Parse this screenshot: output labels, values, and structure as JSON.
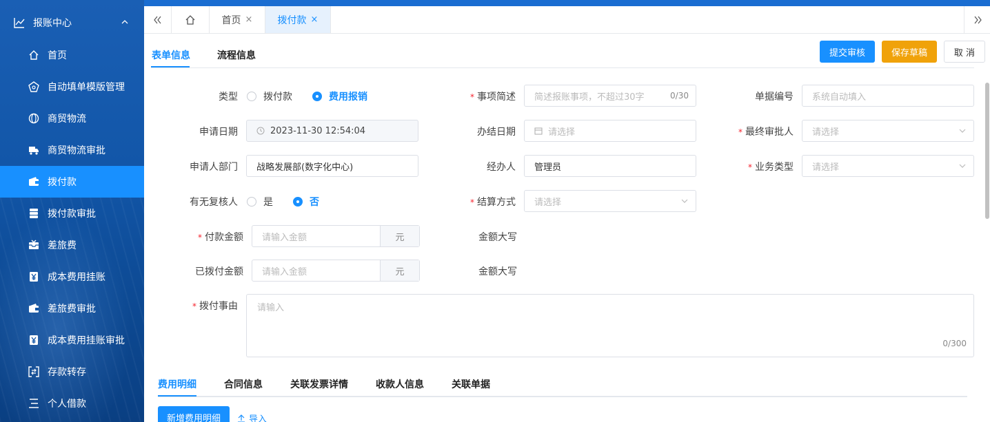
{
  "sidebar": {
    "group_label": "报账中心",
    "items": [
      {
        "label": "首页",
        "icon": "home-icon"
      },
      {
        "label": "自动填单模版管理",
        "icon": "template-icon"
      },
      {
        "label": "商贸物流",
        "icon": "globe-icon"
      },
      {
        "label": "商贸物流审批",
        "icon": "truck-icon"
      },
      {
        "label": "拨付款",
        "icon": "wallet-icon",
        "active": true
      },
      {
        "label": "拨付款审批",
        "icon": "server-icon"
      },
      {
        "label": "差旅费",
        "icon": "inbox-icon"
      },
      {
        "label": "成本费用挂账",
        "icon": "yen-icon"
      },
      {
        "label": "差旅费审批",
        "icon": "wallet-icon"
      },
      {
        "label": "成本费用挂账审批",
        "icon": "yen-icon"
      },
      {
        "label": "存款转存",
        "icon": "transfer-icon"
      },
      {
        "label": "个人借款",
        "icon": "list-icon"
      }
    ]
  },
  "tabbar": {
    "tabs": [
      {
        "label": "首页",
        "close": "×"
      },
      {
        "label": "拨付款",
        "close": "×",
        "active": true
      }
    ]
  },
  "form_header": {
    "tabs": [
      "表单信息",
      "流程信息"
    ],
    "buttons": {
      "submit": "提交审核",
      "save": "保存草稿",
      "cancel": "取 消"
    }
  },
  "form": {
    "type_label": "类型",
    "type_options": [
      "拨付款",
      "费用报销"
    ],
    "type_selected": "费用报销",
    "summary_label": "事项简述",
    "summary_placeholder": "简述报账事项，不超过30字",
    "summary_count": "0/30",
    "doc_no_label": "单据编号",
    "doc_no_placeholder": "系统自动填入",
    "apply_date_label": "申请日期",
    "apply_date_value": "2023-11-30 12:54:04",
    "finish_date_label": "办结日期",
    "finish_date_placeholder": "请选择",
    "final_approver_label": "最终审批人",
    "final_approver_placeholder": "请选择",
    "dept_label": "申请人部门",
    "dept_value": "战略发展部(数字化中心)",
    "handler_label": "经办人",
    "handler_value": "管理员",
    "biz_type_label": "业务类型",
    "biz_type_placeholder": "请选择",
    "recheck_label": "有无复核人",
    "recheck_options": [
      "是",
      "否"
    ],
    "recheck_selected": "否",
    "settle_label": "结算方式",
    "settle_placeholder": "请选择",
    "pay_amount_label": "付款金额",
    "pay_amount_placeholder": "请输入金额",
    "unit": "元",
    "amount_caps_label": "金额大写",
    "paid_amount_label": "已拨付金额",
    "paid_amount_placeholder": "请输入金额",
    "reason_label": "拨付事由",
    "reason_placeholder": "请输入",
    "reason_count": "0/300",
    "required_mark": "*"
  },
  "bottom": {
    "tabs": [
      "费用明细",
      "合同信息",
      "关联发票详情",
      "收款人信息",
      "关联单据"
    ],
    "add_button": "新增费用明细",
    "import_label": "导入"
  }
}
